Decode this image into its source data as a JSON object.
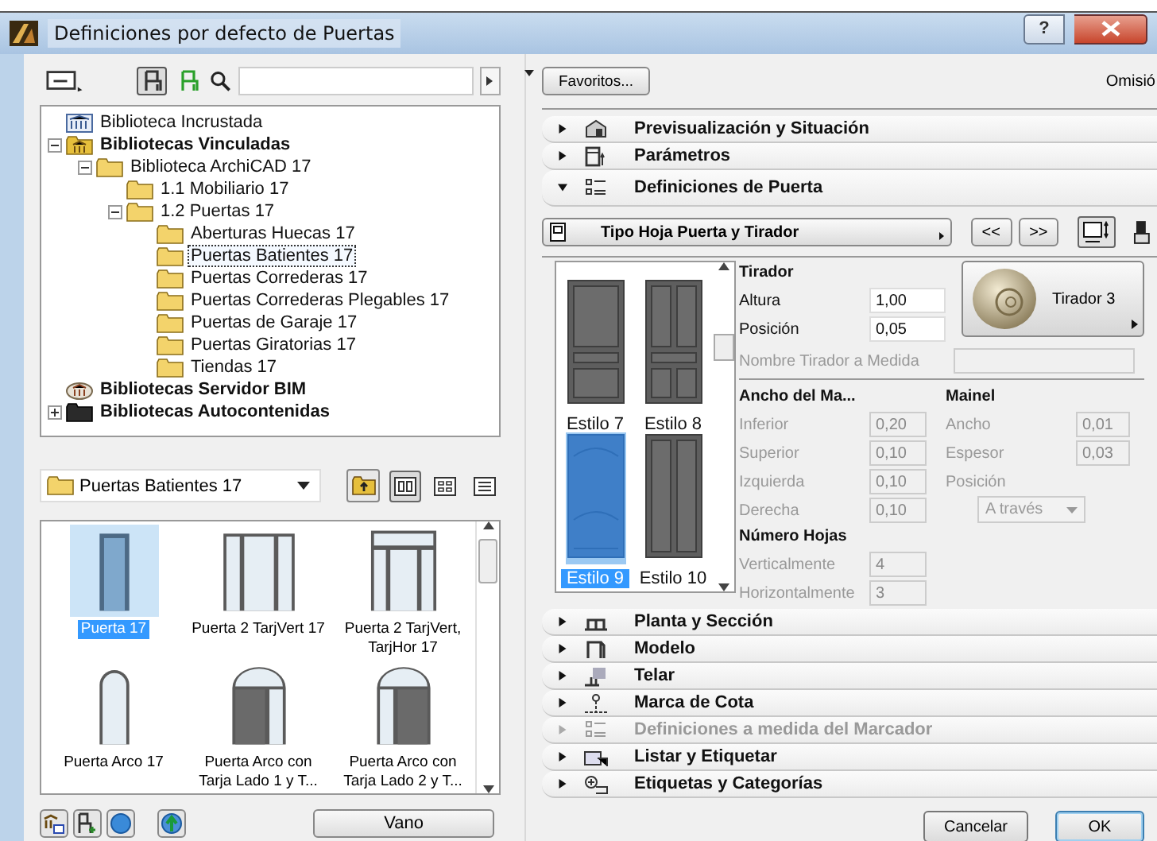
{
  "window": {
    "title": "Definiciones por defecto de Puertas",
    "help": "?"
  },
  "library": {
    "toggles": [
      {
        "kind": "local",
        "selected": true
      },
      {
        "kind": "bim",
        "selected": false
      }
    ],
    "tree": [
      {
        "label": "Biblioteca Incrustada",
        "kind": "embedded",
        "selected": false
      },
      {
        "label": "Bibliotecas Vinculadas",
        "kind": "linked",
        "selected": false,
        "expanded": true,
        "children": [
          {
            "label": "Biblioteca ArchiCAD 17",
            "kind": "folder",
            "selected": false,
            "expanded": true,
            "children": [
              {
                "label": "1.1 Mobiliario 17",
                "kind": "folder",
                "selected": false
              },
              {
                "label": "1.2 Puertas 17",
                "kind": "folder",
                "selected": false,
                "expanded": true,
                "children": [
                  {
                    "label": "Aberturas Huecas 17",
                    "kind": "folder",
                    "selected": false
                  },
                  {
                    "label": "Puertas Batientes 17",
                    "kind": "folder",
                    "selected": true
                  },
                  {
                    "label": "Puertas Correderas 17",
                    "kind": "folder",
                    "selected": false
                  },
                  {
                    "label": "Puertas Correderas Plegables 17",
                    "kind": "folder",
                    "selected": false
                  },
                  {
                    "label": "Puertas de Garaje 17",
                    "kind": "folder",
                    "selected": false
                  },
                  {
                    "label": "Puertas Giratorias 17",
                    "kind": "folder",
                    "selected": false
                  },
                  {
                    "label": "Tiendas 17",
                    "kind": "folder",
                    "selected": false
                  }
                ]
              }
            ]
          }
        ]
      },
      {
        "label": "Bibliotecas Servidor BIM",
        "kind": "bim",
        "selected": false
      },
      {
        "label": "Bibliotecas Autocontenidas",
        "kind": "contained",
        "selected": false,
        "expanded": false
      }
    ],
    "folder": "Puertas Batientes 17",
    "view_modes": [
      {
        "kind": "large",
        "selected": true
      },
      {
        "kind": "small",
        "selected": false
      },
      {
        "kind": "list",
        "selected": false
      }
    ],
    "objects": [
      {
        "label": "Puerta 17",
        "kind": "single",
        "selected": true
      },
      {
        "label": "Puerta 2 TarjVert 17",
        "kind": "sidelights",
        "selected": false
      },
      {
        "label": "Puerta 2 TarjVert, TarjHor 17",
        "kind": "transom",
        "selected": false
      },
      {
        "label": "Puerta Arco 17",
        "kind": "arch",
        "selected": false
      },
      {
        "label": "Puerta Arco con Tarja Lado 1 y T...",
        "kind": "arch-side-1",
        "selected": false
      },
      {
        "label": "Puerta Arco con Tarja Lado 2 y T...",
        "kind": "arch-side-2",
        "selected": false
      }
    ],
    "opening_button": "Vano"
  },
  "settings": {
    "favorites_button": "Favoritos...",
    "defaults_label": "Omisió",
    "sections": [
      {
        "label": "Previsualización y Situación",
        "expanded": false,
        "disabled": false
      },
      {
        "label": "Parámetros",
        "expanded": false,
        "disabled": false
      },
      {
        "label": "Definiciones de Puerta",
        "expanded": true,
        "disabled": false
      },
      {
        "label": "Planta y Sección",
        "expanded": false,
        "disabled": false
      },
      {
        "label": "Modelo",
        "expanded": false,
        "disabled": false
      },
      {
        "label": "Telar",
        "expanded": false,
        "disabled": false
      },
      {
        "label": "Marca de Cota",
        "expanded": false,
        "disabled": false
      },
      {
        "label": "Definiciones a medida del Marcador",
        "expanded": false,
        "disabled": true
      },
      {
        "label": "Listar y Etiquetar",
        "expanded": false,
        "disabled": false
      },
      {
        "label": "Etiquetas y Categorías",
        "expanded": false,
        "disabled": false
      }
    ],
    "door": {
      "page": "Tipo Hoja Puerta y Tirador",
      "prev": "<<",
      "next": ">>",
      "styles": [
        {
          "label": "Estilo 7",
          "kind": "panel-3",
          "selected": false
        },
        {
          "label": "Estilo 8",
          "kind": "panel-6",
          "selected": false
        },
        {
          "label": "Estilo 9",
          "kind": "arched",
          "selected": true
        },
        {
          "label": "Estilo 10",
          "kind": "panel-2v",
          "selected": false
        }
      ],
      "handle": {
        "heading": "Tirador",
        "fields": [
          {
            "label": "Altura",
            "value": "1,00",
            "disabled": false
          },
          {
            "label": "Posición",
            "value": "0,05",
            "disabled": false
          }
        ],
        "button": "Tirador 3",
        "custom_name": {
          "label": "Nombre Tirador a Medida",
          "disabled": true
        }
      },
      "frame": {
        "heading": "Ancho del Ma...",
        "fields": [
          {
            "label": "Inferior",
            "value": "0,20",
            "disabled": true
          },
          {
            "label": "Superior",
            "value": "0,10",
            "disabled": true
          },
          {
            "label": "Izquierda",
            "value": "0,10",
            "disabled": true
          },
          {
            "label": "Derecha",
            "value": "0,10",
            "disabled": true
          }
        ]
      },
      "mullion": {
        "heading": "Mainel",
        "fields": [
          {
            "label": "Ancho",
            "value": "0,01",
            "disabled": true
          },
          {
            "label": "Espesor",
            "value": "0,03",
            "disabled": true
          }
        ],
        "position": {
          "label": "Posición",
          "value": "A través",
          "disabled": true
        }
      },
      "leaves": {
        "heading": "Número Hojas",
        "fields": [
          {
            "label": "Verticalmente",
            "value": "4",
            "disabled": true
          },
          {
            "label": "Horizontalmente",
            "value": "3",
            "disabled": true
          }
        ]
      }
    },
    "buttons": [
      {
        "label": "Cancelar",
        "default": false
      },
      {
        "label": "OK",
        "default": true
      }
    ]
  }
}
